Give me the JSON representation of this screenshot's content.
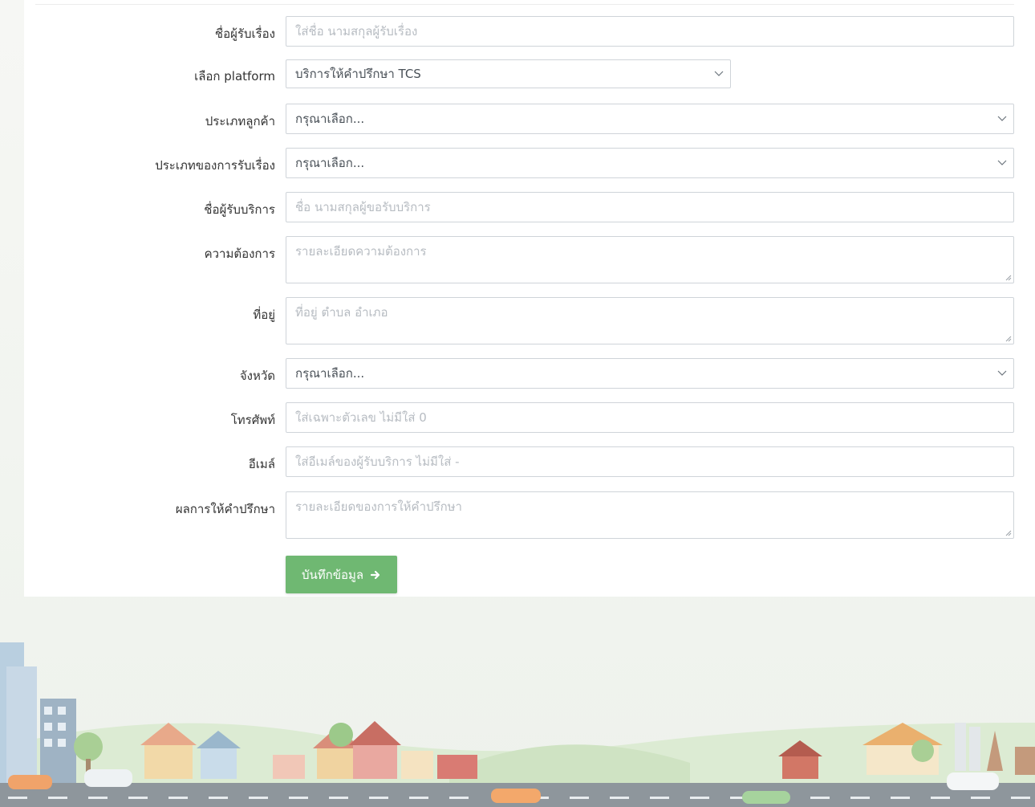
{
  "form": {
    "fields": [
      {
        "label": "ชื่อผู้รับเรื่อง",
        "type": "input",
        "placeholder": "ใส่ชื่อ นามสกุลผู้รับเรื่อง"
      },
      {
        "label": "เลือก platform",
        "type": "select",
        "value": "บริการให้คำปรึกษา TCS"
      },
      {
        "label": "ประเภทลูกค้า",
        "type": "select",
        "value": "กรุณาเลือก..."
      },
      {
        "label": "ประเภทของการรับเรื่อง",
        "type": "select",
        "value": "กรุณาเลือก..."
      },
      {
        "label": "ชื่อผู้รับบริการ",
        "type": "input",
        "placeholder": "ชื่อ นามสกุลผู้ขอรับบริการ"
      },
      {
        "label": "ความต้องการ",
        "type": "textarea",
        "placeholder": "รายละเอียดความต้องการ"
      },
      {
        "label": "ที่อยู่",
        "type": "textarea",
        "placeholder": "ที่อยู่ ตำบล อำเภอ"
      },
      {
        "label": "จังหวัด",
        "type": "select",
        "value": "กรุณาเลือก..."
      },
      {
        "label": "โทรศัพท์",
        "type": "input",
        "placeholder": "ใส่เฉพาะตัวเลข ไม่มีใส่ 0"
      },
      {
        "label": "อีเมล์",
        "type": "input",
        "placeholder": "ใส่อีเมล์ของผู้รับบริการ ไม่มีใส่ -"
      },
      {
        "label": "ผลการให้คำปรึกษา",
        "type": "textarea",
        "placeholder": "รายละเอียดของการให้คำปรึกษา"
      }
    ],
    "submit_label": "บันทึกข้อมูล",
    "submit_icon": "arrow-right-icon"
  },
  "colors": {
    "button": "#6fb872",
    "border": "#cfd4d9",
    "placeholder": "#b7bcc2"
  }
}
